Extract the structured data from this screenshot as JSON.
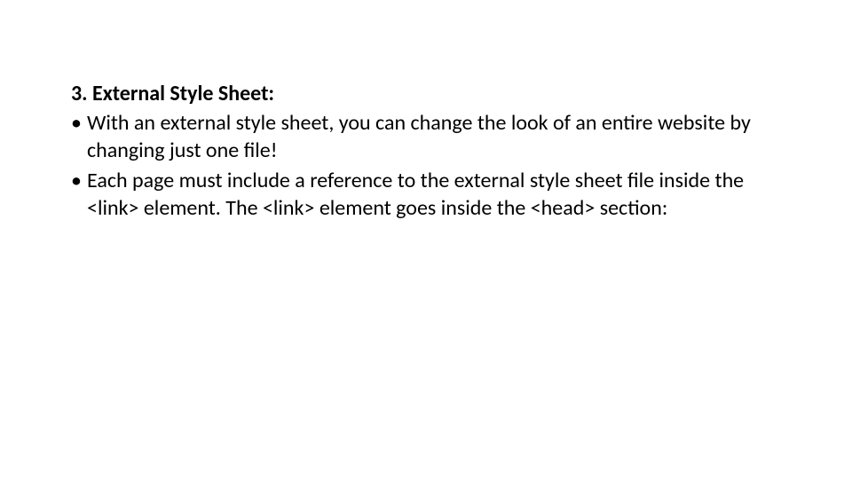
{
  "heading": "3. External Style Sheet:",
  "bullets": [
    {
      "marker": "•",
      "text": "With an external style sheet, you can change the look of an entire website by changing just one file!"
    },
    {
      "marker": "•",
      "text": "Each page must include a reference to the external style sheet file inside the <link> element. The <link> element goes inside the <head> section:"
    }
  ]
}
